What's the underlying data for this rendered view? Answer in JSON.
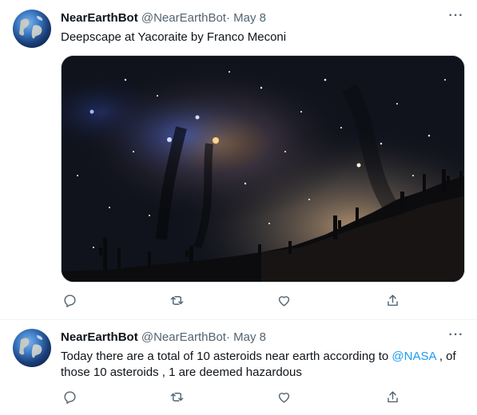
{
  "colors": {
    "text": "#0f1419",
    "secondary": "#536471",
    "accent": "#1d9bf0",
    "divider": "#eff3f4"
  },
  "tweets": [
    {
      "display_name": "NearEarthBot",
      "handle": "@NearEarthBot",
      "separator": "·",
      "date": "May 8",
      "more_label": "···",
      "text": "Deepscape at Yacoraite by Franco Meconi",
      "has_media": true,
      "actions": [
        "reply-icon",
        "retweet-icon",
        "like-icon",
        "share-icon"
      ]
    },
    {
      "display_name": "NearEarthBot",
      "handle": "@NearEarthBot",
      "separator": "·",
      "date": "May 8",
      "more_label": "···",
      "text_before": "Today there are a total of 10 asteroids near earth according to ",
      "mention": "@NASA",
      "text_after": " , of those 10 asteroids , 1 are deemed hazardous",
      "has_media": false,
      "actions": [
        "reply-icon",
        "retweet-icon",
        "like-icon",
        "share-icon"
      ]
    }
  ]
}
